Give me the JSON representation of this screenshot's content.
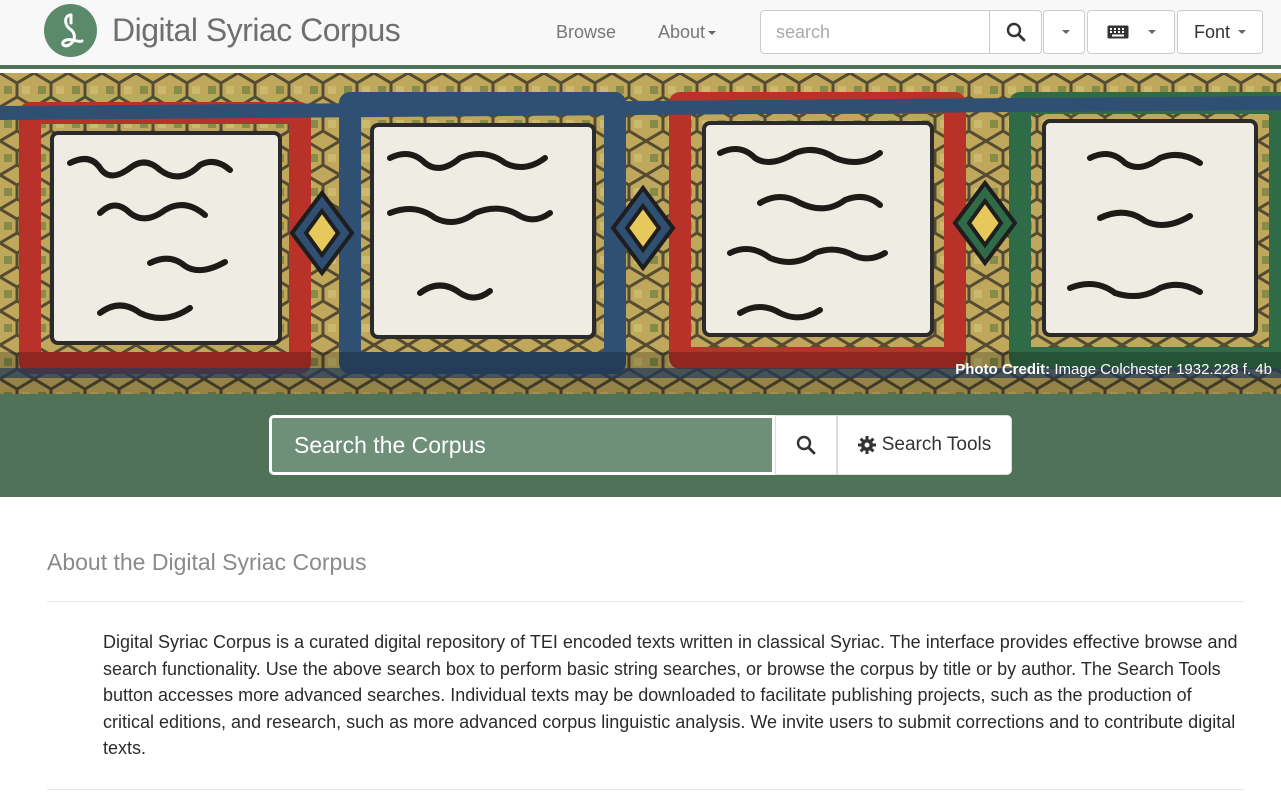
{
  "brand": {
    "title": "Digital Syriac Corpus"
  },
  "nav": {
    "browse": "Browse",
    "about": "About"
  },
  "search": {
    "placeholder": "search"
  },
  "toolbar": {
    "font_label": "Font"
  },
  "hero": {
    "credit_label": "Photo Credit:",
    "credit_text": " Image Colchester 1932.228 f. 4b"
  },
  "main_search": {
    "placeholder": "Search the Corpus",
    "tools_label": "Search Tools"
  },
  "about": {
    "title": "About the Digital Syriac Corpus",
    "text": "Digital Syriac Corpus is a curated digital repository of TEI encoded texts written in classical Syriac. The interface provides effective browse and search functionality. Use the above search box to perform basic string searches, or browse the corpus by title or by author. The Search Tools button accesses more advanced searches. Individual texts may be downloaded to facilitate publishing projects, such as the production of critical editions, and research, such as more advanced corpus linguistic analysis. We invite users to submit corrections and to contribute digital texts."
  },
  "colors": {
    "brand_green": "#4f7259",
    "logo_green": "#5b8a6a",
    "input_green": "#6f8f78"
  }
}
